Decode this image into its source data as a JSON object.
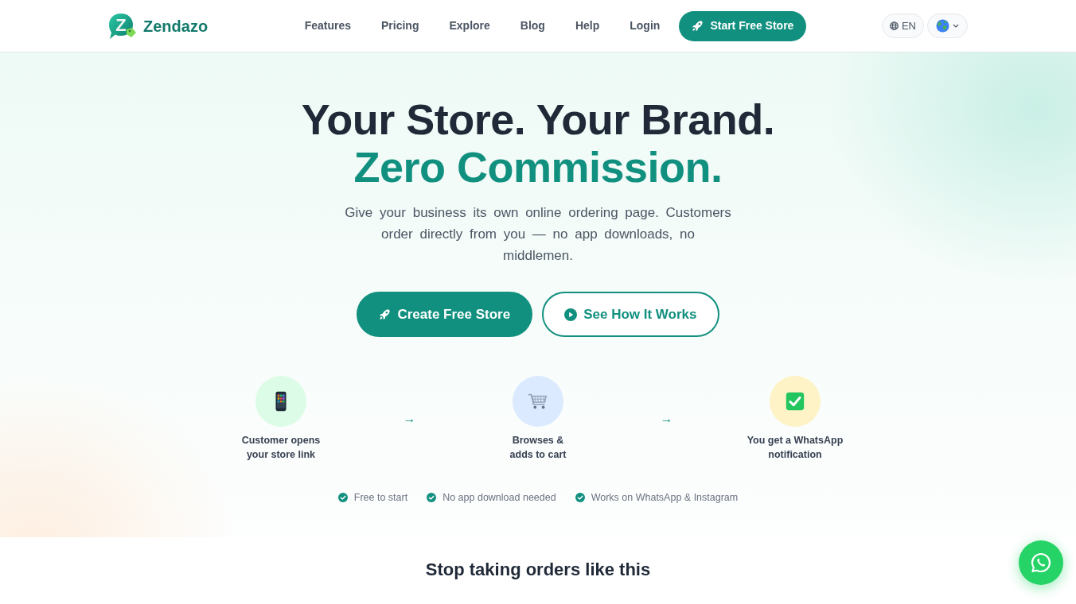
{
  "navbar": {
    "logo_letter": "Z",
    "brand": "Zendazo",
    "links": [
      "Features",
      "Pricing",
      "Explore",
      "Blog",
      "Help",
      "Login"
    ],
    "cta": "Start Free Store",
    "language": "EN"
  },
  "hero": {
    "title_line_1": "Your Store. Your Brand.",
    "title_line_2": "Zero Commission.",
    "subtitle": "Give your business its own online ordering page. Customers order directly from you — no app downloads, no middlemen.",
    "buttons": [
      {
        "label": "Create Free Store",
        "kind": "primary"
      },
      {
        "label": "See How It Works",
        "kind": "outline"
      }
    ]
  },
  "steps": [
    {
      "kind": "phone",
      "color": "#dcfce7",
      "label": "Customer opens your store link"
    },
    {
      "kind": "cart",
      "color": "#dbeafe",
      "label": "Browses & adds to cart"
    },
    {
      "kind": "check",
      "color": "#fef3c7",
      "label": "You get a WhatsApp notification"
    }
  ],
  "step_arrows": [
    "→",
    "→"
  ],
  "perks": [
    "Free to start",
    "No app download needed",
    "Works on WhatsApp & Instagram"
  ],
  "next_section": {
    "title": "Stop taking orders like this"
  }
}
